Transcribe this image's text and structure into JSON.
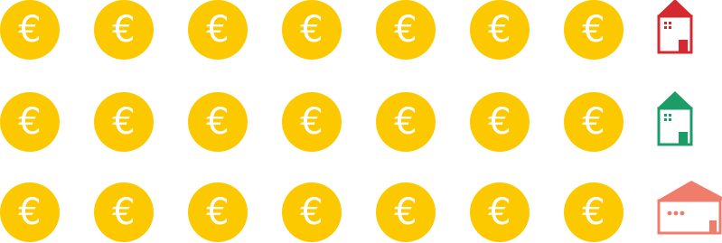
{
  "coin": {
    "symbol": "€",
    "color": "#fcc800",
    "symbol_color": "#ffffff"
  },
  "rows": [
    {
      "coins": 7,
      "house": {
        "type": "house-icon",
        "color": "#d42a2f"
      }
    },
    {
      "coins": 7,
      "house": {
        "type": "house-icon",
        "color": "#1c9c67"
      }
    },
    {
      "coins": 7,
      "house": {
        "type": "wide-house-icon",
        "color": "#f07c6c"
      }
    }
  ]
}
